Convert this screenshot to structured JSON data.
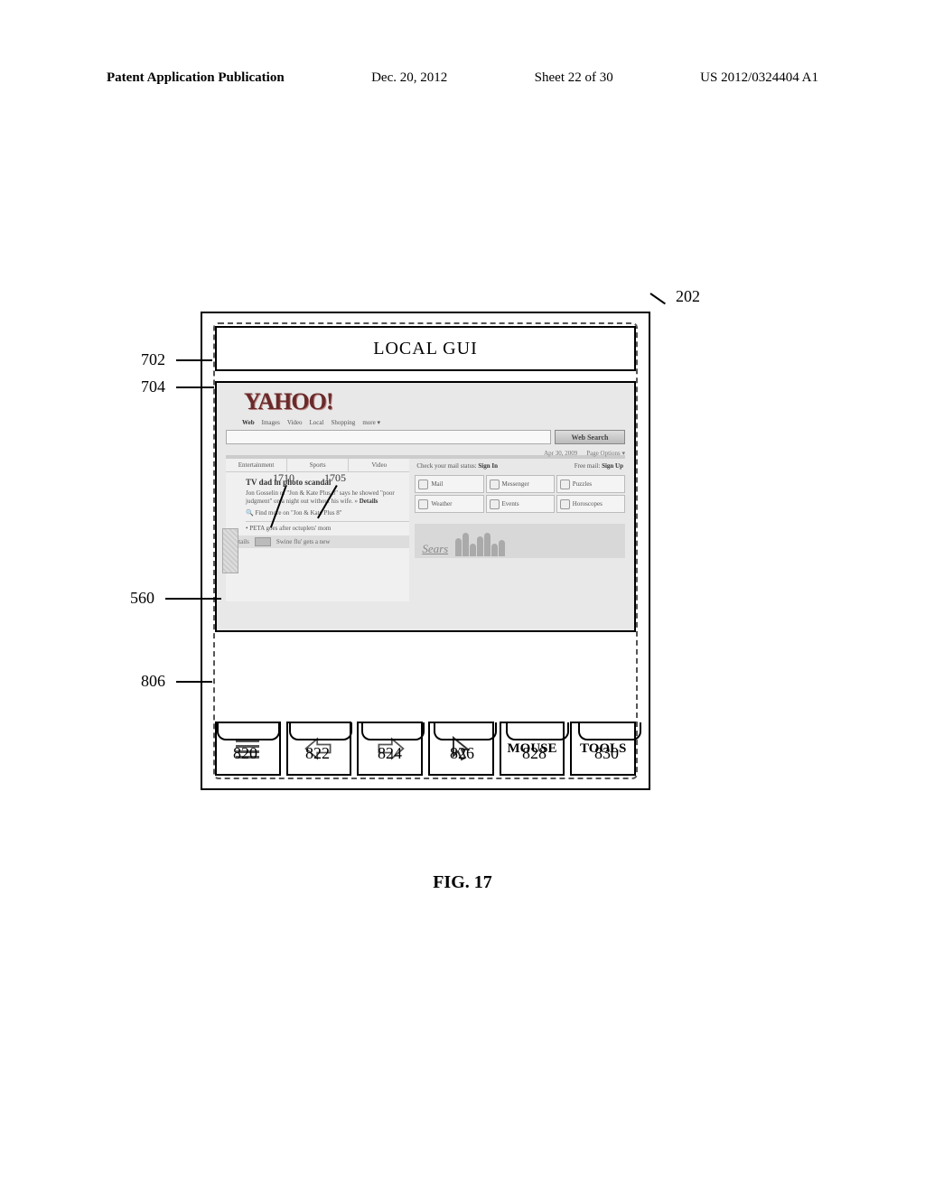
{
  "header": {
    "left": "Patent Application Publication",
    "date": "Dec. 20, 2012",
    "sheet": "Sheet 22 of 30",
    "pubno": "US 2012/0324404 A1"
  },
  "refs": {
    "r202": "202",
    "r702": "702",
    "r704": "704",
    "r560": "560",
    "r806": "806",
    "r820": "820",
    "r822": "822",
    "r824": "824",
    "r826": "826",
    "r828": "828",
    "r830": "830",
    "r1705": "1705",
    "r1710": "1710"
  },
  "gui": {
    "title": "LOCAL GUI",
    "yahoo_logo": "YAHOO!",
    "tabs": [
      "Web",
      "Images",
      "Video",
      "Local",
      "Shopping",
      "more ▾"
    ],
    "search_btn": "Web Search",
    "date_text": "Apr 30, 2009",
    "page_options": "Page Options ▾",
    "left_tabs": [
      "Entertainment",
      "Sports",
      "Video"
    ],
    "headline": "TV dad in photo scandal",
    "story_body": "Jon Gosselin of \"Jon & Kate Plus 8\" says he showed \"poor judgment\" on a night out without his wife.  » ",
    "details_label": "Details",
    "find_more": "Find more on \"Jon & Kate Plus 8\"",
    "peta": "• PETA goes after octuplets' mom",
    "footer_label": "Swine flu' gets a new",
    "footer_left": "Details",
    "mail_status": "Check your mail status:",
    "sign_in": "Sign In",
    "free_mail": "Free mail:",
    "sign_up": "Sign Up",
    "tiles": [
      {
        "label": "Mail"
      },
      {
        "label": "Messenger"
      },
      {
        "label": "Puzzles"
      },
      {
        "label": "Weather"
      },
      {
        "label": "Events"
      },
      {
        "label": "Horoscopes"
      }
    ],
    "sears": "Sears"
  },
  "toolbar": {
    "mouse": "MOUSE",
    "tools": "TOOLS"
  },
  "fig": "FIG. 17"
}
